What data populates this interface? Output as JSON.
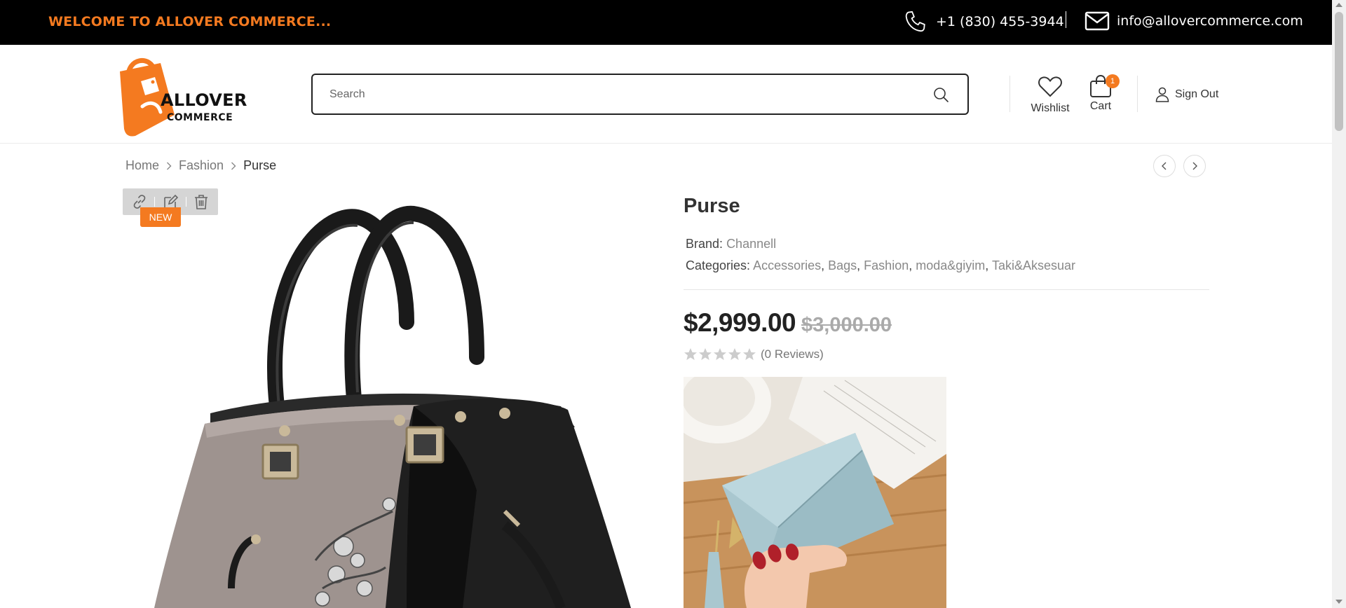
{
  "topbar": {
    "welcome": "WELCOME TO ALLOVER COMMERCE...",
    "phone": "+1 (830) 455-3944",
    "email": "info@allovercommerce.com",
    "phone_icon": "phone-icon",
    "email_icon": "envelope-icon"
  },
  "header": {
    "logo_title": "ALLOVER",
    "logo_sub": "COMMERCE",
    "search_placeholder": "Search",
    "wishlist_label": "Wishlist",
    "cart_label": "Cart",
    "cart_count": "1",
    "signout_label": "Sign Out"
  },
  "breadcrumb": {
    "items": [
      "Home",
      "Fashion"
    ],
    "current": "Purse"
  },
  "product": {
    "badge": "NEW",
    "title": "Purse",
    "brand_label": "Brand:",
    "brand_value": "Channell",
    "categories_label": "Categories:",
    "categories": [
      "Accessories",
      "Bags",
      "Fashion",
      "moda&giyim",
      "Taki&Aksesuar"
    ],
    "price": "$2,999.00",
    "old_price": "$3,000.00",
    "rating": 0,
    "reviews": "(0 Reviews)"
  },
  "colors": {
    "accent": "#f47a20",
    "topbar_bg": "#000000"
  }
}
